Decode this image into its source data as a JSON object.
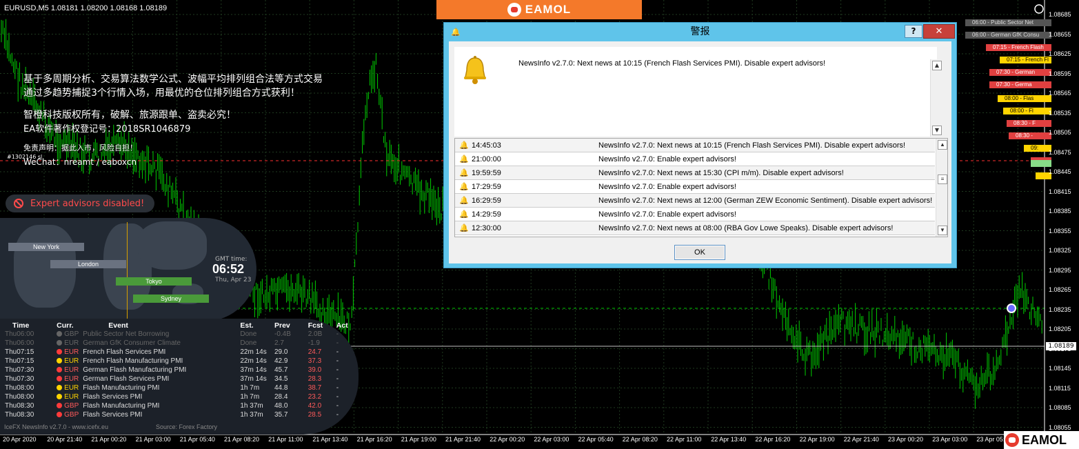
{
  "chart_header": "EURUSD,M5  1.08181 1.08200 1.08168 1.08189",
  "overlay_text": {
    "line1": "基于多周期分析、交易算法数学公式、波幅平均排列组合法等方式交易",
    "line2": "通过多趋势捕捉3个行情入场，用最优的仓位排列组合方式获利！",
    "line3": "智橙科技版权所有，破解、旅源跟单、盗卖必究！",
    "line4": "EA软件著作权登记号：2018SR1046879",
    "line5": "免责声明：据此入市，风险自担！",
    "line6": "WeChat：nreamt / eaboxcn",
    "order_label": "#1302146 sl"
  },
  "ea_status": "Expert advisors disabled!",
  "sessions": {
    "items": [
      {
        "name": "New York"
      },
      {
        "name": "London"
      },
      {
        "name": "Tokyo"
      },
      {
        "name": "Sydney"
      }
    ],
    "gmt_label": "GMT time:",
    "gmt_time": "06:52",
    "gmt_date": "Thu, Apr 23"
  },
  "news_table": {
    "headers": [
      "Time",
      "Curr.",
      "Event",
      "Est.",
      "Prev",
      "Fcst",
      "Act"
    ],
    "rows": [
      {
        "day": "Thu",
        "time": "06:00",
        "dot": "#666666",
        "curr": "GBP",
        "event": "Public Sector Net Borrowing",
        "est": "Done",
        "prev": "-0.4B",
        "fcst": "2.0B",
        "act": "-",
        "dim": true
      },
      {
        "day": "Thu",
        "time": "06:00",
        "dot": "#666666",
        "curr": "EUR",
        "event": "German GfK Consumer Climate",
        "est": "Done",
        "prev": "2.7",
        "fcst": "-1.9",
        "act": "-",
        "dim": true
      },
      {
        "day": "Thu",
        "time": "07:15",
        "dot": "#ff3b3b",
        "curr": "EUR",
        "event": "French Flash Services PMI",
        "est": "22m 14s",
        "prev": "29.0",
        "fcst": "24.7",
        "act": "-",
        "dim": false
      },
      {
        "day": "Thu",
        "time": "07:15",
        "dot": "#ffd400",
        "curr": "EUR",
        "event": "French Flash Manufacturing PMI",
        "est": "22m 14s",
        "prev": "42.9",
        "fcst": "37.3",
        "act": "-",
        "dim": false
      },
      {
        "day": "Thu",
        "time": "07:30",
        "dot": "#ff3b3b",
        "curr": "EUR",
        "event": "German Flash Manufacturing PMI",
        "est": "37m 14s",
        "prev": "45.7",
        "fcst": "39.0",
        "act": "-",
        "dim": false
      },
      {
        "day": "Thu",
        "time": "07:30",
        "dot": "#ff3b3b",
        "curr": "EUR",
        "event": "German Flash Services PMI",
        "est": "37m 14s",
        "prev": "34.5",
        "fcst": "28.3",
        "act": "-",
        "dim": false
      },
      {
        "day": "Thu",
        "time": "08:00",
        "dot": "#ffd400",
        "curr": "EUR",
        "event": "Flash Manufacturing PMI",
        "est": "1h 7m",
        "prev": "44.8",
        "fcst": "38.7",
        "act": "-",
        "dim": false
      },
      {
        "day": "Thu",
        "time": "08:00",
        "dot": "#ffd400",
        "curr": "EUR",
        "event": "Flash Services PMI",
        "est": "1h 7m",
        "prev": "28.4",
        "fcst": "23.2",
        "act": "-",
        "dim": false
      },
      {
        "day": "Thu",
        "time": "08:30",
        "dot": "#ff3b3b",
        "curr": "GBP",
        "event": "Flash Manufacturing PMI",
        "est": "1h 37m",
        "prev": "48.0",
        "fcst": "42.0",
        "act": "-",
        "dim": false
      },
      {
        "day": "Thu",
        "time": "08:30",
        "dot": "#ff3b3b",
        "curr": "GBP",
        "event": "Flash Services PMI",
        "est": "1h 37m",
        "prev": "35.7",
        "fcst": "28.5",
        "act": "-",
        "dim": false
      }
    ],
    "footer_left": "IceFX NewsInfo v2.7.0 - www.icefx.eu",
    "footer_right": "Source: Forex Factory"
  },
  "price_axis": {
    "labels": [
      "1.08685",
      "1.08655",
      "1.08625",
      "1.08595",
      "1.08565",
      "1.08535",
      "1.08505",
      "1.08475",
      "1.08445",
      "1.08415",
      "1.08385",
      "1.08355",
      "1.08325",
      "1.08295",
      "1.08265",
      "1.08235",
      "1.08205",
      "1.08175",
      "1.08145",
      "1.08115",
      "1.08085",
      "1.08055"
    ],
    "current_price": "1.08189"
  },
  "time_axis": {
    "labels": [
      "20 Apr 2020",
      "20 Apr 21:40",
      "21 Apr 00:20",
      "21 Apr 03:00",
      "21 Apr 05:40",
      "21 Apr 08:20",
      "21 Apr 11:00",
      "21 Apr 13:40",
      "21 Apr 16:20",
      "21 Apr 19:00",
      "21 Apr 21:40",
      "22 Apr 00:20",
      "22 Apr 03:00",
      "22 Apr 05:40",
      "22 Apr 08:20",
      "22 Apr 11:00",
      "22 Apr 13:40",
      "22 Apr 16:20",
      "22 Apr 19:00",
      "22 Apr 21:40",
      "23 Apr 00:20",
      "23 Apr 03:00",
      "23 Apr 05:40"
    ]
  },
  "event_bars": [
    {
      "label": "06:00 - Public Sector Net",
      "color": "#555555",
      "text": "#dddddd"
    },
    {
      "label": "06:00 - German GfK Consu",
      "color": "#555555",
      "text": "#dddddd"
    },
    {
      "label": "07:15 - French Flash",
      "color": "#e04040",
      "text": "#ffffff"
    },
    {
      "label": "07:15 - French Fl",
      "color": "#ffd400",
      "text": "#000000"
    },
    {
      "label": "07:30 - German",
      "color": "#e04040",
      "text": "#ffffff"
    },
    {
      "label": "07:30 - Germa",
      "color": "#e04040",
      "text": "#ffffff"
    },
    {
      "label": "08:00 - Flas",
      "color": "#ffd400",
      "text": "#000000"
    },
    {
      "label": "08:00 - Fl",
      "color": "#ffd400",
      "text": "#000000"
    },
    {
      "label": "08:30 - F",
      "color": "#e04040",
      "text": "#ffffff"
    },
    {
      "label": "08:30 -",
      "color": "#e04040",
      "text": "#ffffff"
    },
    {
      "label": "09:",
      "color": "#ffd400",
      "text": "#000000"
    },
    {
      "label": "",
      "color": "#e04040",
      "text": "#ffffff"
    },
    {
      "label": "",
      "color": "#88dd88",
      "text": "#000000"
    },
    {
      "label": "",
      "color": "#ffd400",
      "text": "#000000"
    }
  ],
  "banner": {
    "brand": "EAMOL"
  },
  "logo_corner": {
    "brand": "EAMOL"
  },
  "dialog": {
    "title": "警报",
    "help": "?",
    "close": "✕",
    "message": "NewsInfo v2.7.0: Next news at 10:15 (French Flash Services PMI). Disable expert advisors!",
    "list": [
      {
        "time": "14:45:03",
        "text": "NewsInfo v2.7.0: Next news at 10:15 (French Flash Services PMI). Disable expert advisors!"
      },
      {
        "time": "21:00:00",
        "text": "NewsInfo v2.7.0: Enable expert advisors!"
      },
      {
        "time": "19:59:59",
        "text": "NewsInfo v2.7.0: Next news at 15:30 (CPI m/m). Disable expert advisors!"
      },
      {
        "time": "17:29:59",
        "text": "NewsInfo v2.7.0: Enable expert advisors!"
      },
      {
        "time": "16:29:59",
        "text": "NewsInfo v2.7.0: Next news at 12:00 (German ZEW Economic Sentiment). Disable expert advisors!"
      },
      {
        "time": "14:29:59",
        "text": "NewsInfo v2.7.0: Enable expert advisors!"
      },
      {
        "time": "12:30:00",
        "text": "NewsInfo v2.7.0: Next news at 08:00 (RBA Gov Lowe Speaks). Disable expert advisors!"
      }
    ],
    "ok": "OK"
  },
  "colors": {
    "candle": "#00c800",
    "grid": "#1a3a1a",
    "bid_line": "#ffffff",
    "order_line": "#ff3030",
    "ask_line": "#00c800"
  }
}
